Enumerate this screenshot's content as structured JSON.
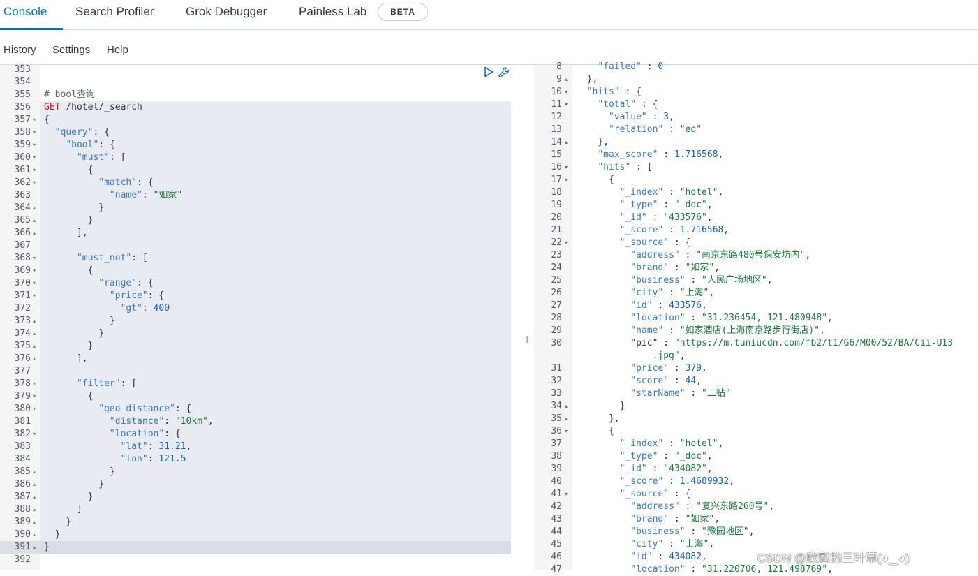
{
  "nav": {
    "tabs": [
      {
        "label": "Console",
        "active": true
      },
      {
        "label": "Search Profiler",
        "active": false
      },
      {
        "label": "Grok Debugger",
        "active": false
      },
      {
        "label": "Painless Lab",
        "active": false
      }
    ],
    "beta_badge": "BETA"
  },
  "menu": {
    "history": "History",
    "settings": "Settings",
    "help": "Help"
  },
  "colors": {
    "accent": "#006bb4",
    "string": "#1b7a3a",
    "key": "#3a7bbf",
    "method": "#c01c28"
  },
  "toolbar_icons": [
    "play-icon",
    "wrench-icon"
  ],
  "request_editor": {
    "lines": [
      {
        "n": "353",
        "t": "",
        "f": ""
      },
      {
        "n": "354",
        "t": "",
        "f": ""
      },
      {
        "n": "355",
        "t": "# bool查询",
        "f": ""
      },
      {
        "n": "356",
        "t": "GET /hotel/_search",
        "f": ""
      },
      {
        "n": "357",
        "t": "{",
        "f": "down"
      },
      {
        "n": "358",
        "t": "  \"query\": {",
        "f": "down"
      },
      {
        "n": "359",
        "t": "    \"bool\": {",
        "f": "down"
      },
      {
        "n": "360",
        "t": "      \"must\": [",
        "f": "down"
      },
      {
        "n": "361",
        "t": "        {",
        "f": "down"
      },
      {
        "n": "362",
        "t": "          \"match\": {",
        "f": "down"
      },
      {
        "n": "363",
        "t": "            \"name\": \"如家\"",
        "f": ""
      },
      {
        "n": "364",
        "t": "          }",
        "f": "up"
      },
      {
        "n": "365",
        "t": "        }",
        "f": "up"
      },
      {
        "n": "366",
        "t": "      ],",
        "f": "up"
      },
      {
        "n": "367",
        "t": "",
        "f": ""
      },
      {
        "n": "368",
        "t": "      \"must_not\": [",
        "f": "down"
      },
      {
        "n": "369",
        "t": "        {",
        "f": "down"
      },
      {
        "n": "370",
        "t": "          \"range\": {",
        "f": "down"
      },
      {
        "n": "371",
        "t": "            \"price\": {",
        "f": "down"
      },
      {
        "n": "372",
        "t": "              \"gt\": 400",
        "f": ""
      },
      {
        "n": "373",
        "t": "            }",
        "f": "up"
      },
      {
        "n": "374",
        "t": "          }",
        "f": "up"
      },
      {
        "n": "375",
        "t": "        }",
        "f": "up"
      },
      {
        "n": "376",
        "t": "      ],",
        "f": "up"
      },
      {
        "n": "377",
        "t": "",
        "f": ""
      },
      {
        "n": "378",
        "t": "      \"filter\": [",
        "f": "down"
      },
      {
        "n": "379",
        "t": "        {",
        "f": "down"
      },
      {
        "n": "380",
        "t": "          \"geo_distance\": {",
        "f": "down"
      },
      {
        "n": "381",
        "t": "            \"distance\": \"10km\",",
        "f": ""
      },
      {
        "n": "382",
        "t": "            \"location\": {",
        "f": "down"
      },
      {
        "n": "383",
        "t": "              \"lat\": 31.21,",
        "f": ""
      },
      {
        "n": "384",
        "t": "              \"lon\": 121.5",
        "f": ""
      },
      {
        "n": "385",
        "t": "            }",
        "f": "up"
      },
      {
        "n": "386",
        "t": "          }",
        "f": "up"
      },
      {
        "n": "387",
        "t": "        }",
        "f": "up"
      },
      {
        "n": "388",
        "t": "      ]",
        "f": "up"
      },
      {
        "n": "389",
        "t": "    }",
        "f": "up"
      },
      {
        "n": "390",
        "t": "  }",
        "f": "up"
      },
      {
        "n": "391",
        "t": "}",
        "f": "up"
      },
      {
        "n": "392",
        "t": "",
        "f": ""
      }
    ]
  },
  "response_viewer": {
    "lines": [
      {
        "n": "8",
        "t": "    \"failed\" : 0",
        "f": ""
      },
      {
        "n": "9",
        "t": "  },",
        "f": "up"
      },
      {
        "n": "10",
        "t": "  \"hits\" : {",
        "f": "down"
      },
      {
        "n": "11",
        "t": "    \"total\" : {",
        "f": "down"
      },
      {
        "n": "12",
        "t": "      \"value\" : 3,",
        "f": ""
      },
      {
        "n": "13",
        "t": "      \"relation\" : \"eq\"",
        "f": ""
      },
      {
        "n": "14",
        "t": "    },",
        "f": "up"
      },
      {
        "n": "15",
        "t": "    \"max_score\" : 1.716568,",
        "f": ""
      },
      {
        "n": "16",
        "t": "    \"hits\" : [",
        "f": "down"
      },
      {
        "n": "17",
        "t": "      {",
        "f": "down"
      },
      {
        "n": "18",
        "t": "        \"_index\" : \"hotel\",",
        "f": ""
      },
      {
        "n": "19",
        "t": "        \"_type\" : \"_doc\",",
        "f": ""
      },
      {
        "n": "20",
        "t": "        \"_id\" : \"433576\",",
        "f": ""
      },
      {
        "n": "21",
        "t": "        \"_score\" : 1.716568,",
        "f": ""
      },
      {
        "n": "22",
        "t": "        \"_source\" : {",
        "f": "down"
      },
      {
        "n": "23",
        "t": "          \"address\" : \"南京东路480号保安坊内\",",
        "f": ""
      },
      {
        "n": "24",
        "t": "          \"brand\" : \"如家\",",
        "f": ""
      },
      {
        "n": "25",
        "t": "          \"business\" : \"人民广场地区\",",
        "f": ""
      },
      {
        "n": "26",
        "t": "          \"city\" : \"上海\",",
        "f": ""
      },
      {
        "n": "27",
        "t": "          \"id\" : 433576,",
        "f": ""
      },
      {
        "n": "28",
        "t": "          \"location\" : \"31.236454, 121.480948\",",
        "f": ""
      },
      {
        "n": "29",
        "t": "          \"name\" : \"如家酒店(上海南京路步行街店)\",",
        "f": ""
      },
      {
        "n": "30",
        "t": "          \"pic\" : \"https://m.tuniucdn.com/fb2/t1/G6/M00/52/BA/Cii-U13",
        "f": ""
      },
      {
        "n": "",
        "t": "              .jpg\",",
        "f": ""
      },
      {
        "n": "31",
        "t": "          \"price\" : 379,",
        "f": ""
      },
      {
        "n": "32",
        "t": "          \"score\" : 44,",
        "f": ""
      },
      {
        "n": "33",
        "t": "          \"starName\" : \"二钻\"",
        "f": ""
      },
      {
        "n": "34",
        "t": "        }",
        "f": "up"
      },
      {
        "n": "35",
        "t": "      },",
        "f": "up"
      },
      {
        "n": "36",
        "t": "      {",
        "f": "down"
      },
      {
        "n": "37",
        "t": "        \"_index\" : \"hotel\",",
        "f": ""
      },
      {
        "n": "38",
        "t": "        \"_type\" : \"_doc\",",
        "f": ""
      },
      {
        "n": "39",
        "t": "        \"_id\" : \"434082\",",
        "f": ""
      },
      {
        "n": "40",
        "t": "        \"_score\" : 1.4689932,",
        "f": ""
      },
      {
        "n": "41",
        "t": "        \"_source\" : {",
        "f": "down"
      },
      {
        "n": "42",
        "t": "          \"address\" : \"复兴东路260号\",",
        "f": ""
      },
      {
        "n": "43",
        "t": "          \"brand\" : \"如家\",",
        "f": ""
      },
      {
        "n": "44",
        "t": "          \"business\" : \"豫园地区\",",
        "f": ""
      },
      {
        "n": "45",
        "t": "          \"city\" : \"上海\",",
        "f": ""
      },
      {
        "n": "46",
        "t": "          \"id\" : 434082,",
        "f": ""
      },
      {
        "n": "47",
        "t": "          \"location\" : \"31.220706, 121.498769\",",
        "f": ""
      }
    ]
  },
  "watermark": "CSDN @欣慰的三叶草(◕‿◕)"
}
